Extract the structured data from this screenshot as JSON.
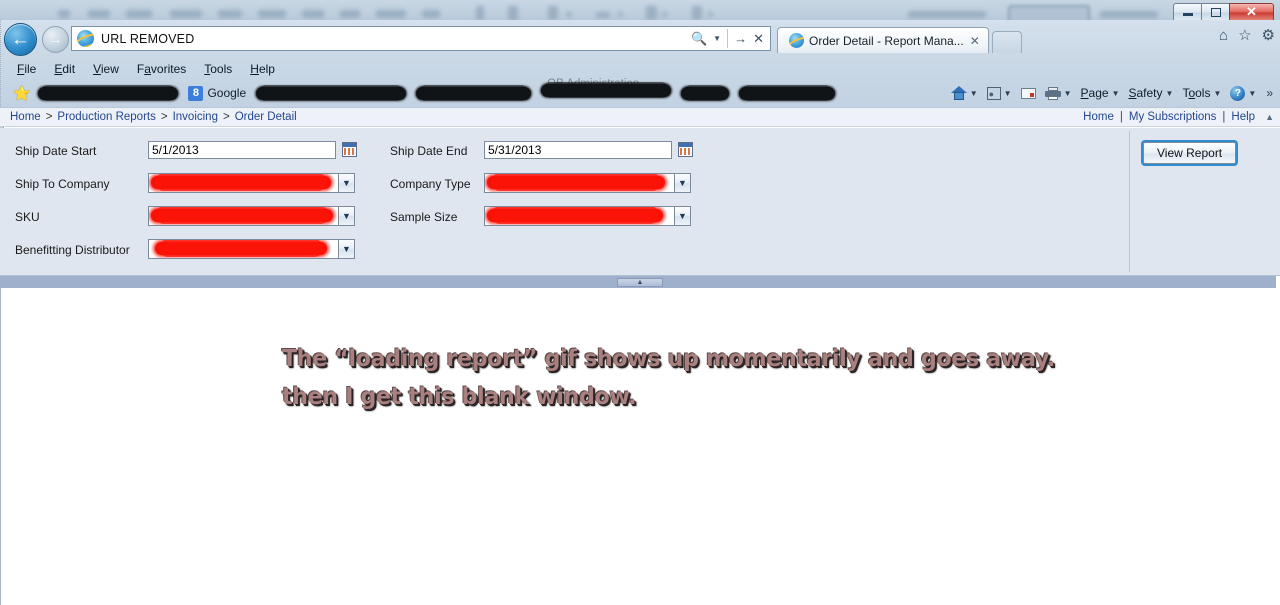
{
  "window": {
    "controls": {
      "minimize": "minimize",
      "maximize": "maximize",
      "close": "✕"
    }
  },
  "browser": {
    "address_value": "URL REMOVED",
    "address_icons": [
      "search-dropdown",
      "go",
      "stop"
    ],
    "nav": {
      "back": "←",
      "forward": "→"
    },
    "tab": {
      "title": "Order Detail - Report Mana...",
      "close": "✕"
    },
    "new_tab_label": "",
    "chrome_icons": [
      "home-icon",
      "favorites-star-icon",
      "tools-gear-icon"
    ],
    "menu": [
      {
        "label": "File",
        "accel": "F",
        "rest": "ile"
      },
      {
        "label": "Edit",
        "accel": "E",
        "rest": "dit"
      },
      {
        "label": "View",
        "accel": "V",
        "rest": "iew"
      },
      {
        "label": "Favorites",
        "accel": "a",
        "pre": "F",
        "rest": "vorites"
      },
      {
        "label": "Tools",
        "accel": "T",
        "rest": "ools"
      },
      {
        "label": "Help",
        "accel": "H",
        "rest": "elp"
      }
    ],
    "favorites": {
      "star": "★",
      "google_label": "Google",
      "google_badge": "8",
      "redacted_items": [
        {
          "width": 140
        },
        {
          "width": 150
        },
        {
          "width": 130
        },
        {
          "width": 135
        },
        {
          "width": 50
        },
        {
          "width": 95
        }
      ],
      "ghost_text": "OB Administration"
    },
    "command_bar": [
      {
        "name": "home",
        "label": "",
        "icon": "home-icon",
        "caret": "▼"
      },
      {
        "name": "feeds",
        "label": "",
        "icon": "rss-icon",
        "caret": "▼"
      },
      {
        "name": "read-mail",
        "label": "",
        "icon": "mail-icon",
        "caret": ""
      },
      {
        "name": "print",
        "label": "",
        "icon": "printer-icon",
        "caret": "▼"
      },
      {
        "name": "page",
        "label": "Page",
        "accel": "P",
        "rest": "age",
        "icon": "",
        "caret": "▼"
      },
      {
        "name": "safety",
        "label": "Safety",
        "accel": "S",
        "rest": "afety",
        "icon": "",
        "caret": "▼"
      },
      {
        "name": "tools",
        "label": "Tools",
        "pre": "T",
        "accel": "o",
        "rest": "ols",
        "icon": "",
        "caret": "▼"
      },
      {
        "name": "help",
        "label": "",
        "icon": "help-icon",
        "caret": "▼"
      }
    ],
    "overflow": "»"
  },
  "report_viewer": {
    "breadcrumb": [
      {
        "label": "Home",
        "link": true
      },
      {
        "label": "Production Reports",
        "link": true
      },
      {
        "label": "Invoicing",
        "link": true
      },
      {
        "label": "Order Detail",
        "link": false
      }
    ],
    "breadcrumb_separator": ">",
    "right_links": [
      {
        "label": "Home"
      },
      {
        "label": "My Subscriptions"
      },
      {
        "label": "Help"
      }
    ],
    "right_links_separator": "|",
    "scroll_up": "▲",
    "parameters": {
      "ship_date_start": {
        "label": "Ship Date Start",
        "value": "5/1/2013",
        "type": "date"
      },
      "ship_date_end": {
        "label": "Ship Date End",
        "value": "5/31/2013",
        "type": "date"
      },
      "ship_to_company": {
        "label": "Ship To Company",
        "value": "",
        "redacted": true,
        "type": "select"
      },
      "company_type": {
        "label": "Company Type",
        "value": "",
        "redacted": true,
        "type": "select"
      },
      "sku": {
        "label": "SKU",
        "value": "",
        "redacted": true,
        "type": "select"
      },
      "sample_size": {
        "label": "Sample Size",
        "value": "",
        "redacted": true,
        "type": "select"
      },
      "benefitting_distributor": {
        "label": "Benefitting Distributor",
        "value": "",
        "redacted": true,
        "type": "select"
      }
    },
    "view_report_label": "View Report",
    "collapse_handle": "▲"
  },
  "annotation": {
    "line1": "The “loading report” gif shows up momentarily and goes away.",
    "line2": "then I get this blank window.",
    "color": "#a8807f"
  }
}
